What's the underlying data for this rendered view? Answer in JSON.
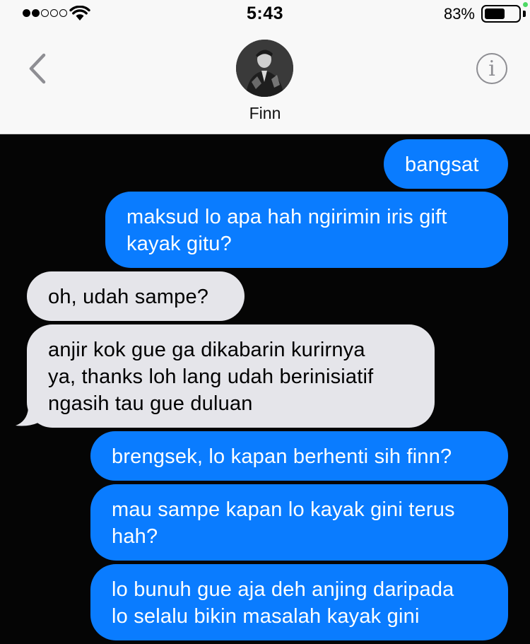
{
  "status_bar": {
    "time": "5:43",
    "battery": "83%",
    "battery_level": 0.83,
    "signal_dots_filled": 2,
    "signal_dots_total": 5
  },
  "nav": {
    "contact_name": "Finn",
    "info_glyph": "i"
  },
  "colors": {
    "sent_bubble": "#0a7cff",
    "received_bubble": "#e5e5ea",
    "thread_background": "#050505",
    "header_background": "#f8f8f8"
  },
  "messages": [
    {
      "direction": "sent",
      "text": "bangsat"
    },
    {
      "direction": "sent",
      "text": "maksud lo apa hah ngirimin iris gift\nkayak gitu?"
    },
    {
      "direction": "received",
      "text": "oh, udah sampe?"
    },
    {
      "direction": "received",
      "text": "anjir kok gue ga dikabarin kurirnya\nya, thanks loh lang udah berinisiatif\nngasih tau gue duluan"
    },
    {
      "direction": "sent",
      "text": "brengsek, lo kapan berhenti sih finn?"
    },
    {
      "direction": "sent",
      "text": "mau sampe kapan lo kayak gini terus\nhah?"
    },
    {
      "direction": "sent",
      "text": "lo bunuh gue aja deh anjing daripada\nlo selalu bikin masalah kayak gini"
    }
  ]
}
